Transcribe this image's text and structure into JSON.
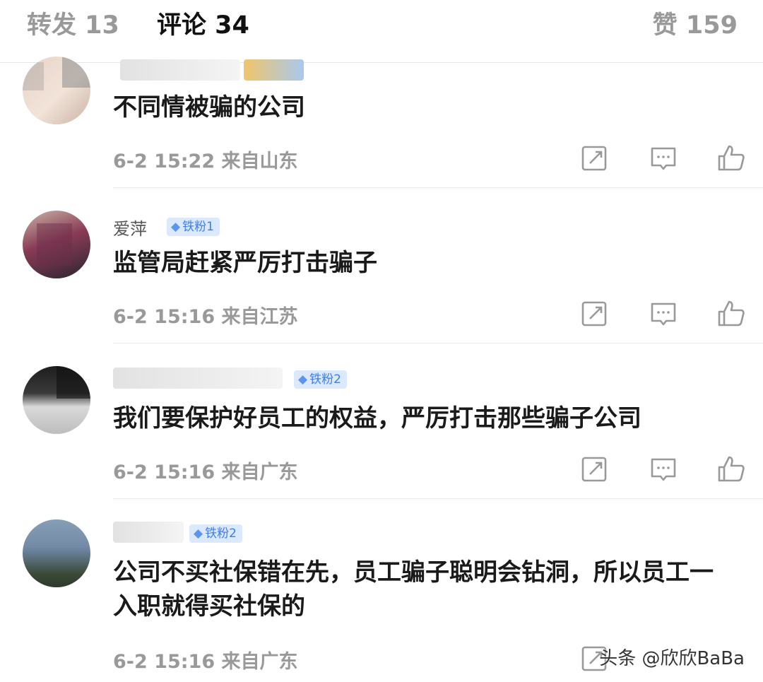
{
  "tabs": {
    "repost": "转发 13",
    "comments": "评论 34",
    "likes": "赞 159"
  },
  "comments": [
    {
      "user": "",
      "badge": "",
      "text": "不同情被骗的公司",
      "time": "6-2 15:22 来自山东"
    },
    {
      "user": "爱萍",
      "badge": "铁粉1",
      "text": "监管局赶紧严厉打击骗子",
      "time": "6-2 15:16 来自江苏"
    },
    {
      "user": "",
      "badge": "铁粉2",
      "text": "我们要保护好员工的权益，严厉打击那些骗子公司",
      "time": "6-2 15:16 来自广东"
    },
    {
      "user": "",
      "badge": "铁粉2",
      "text": "公司不买社保错在先，员工骗子聪明会钻洞，所以员工一入职就得买社保的",
      "time": "6-2 15:16 来自广东"
    }
  ],
  "icons": [
    "repost-icon",
    "reply-icon",
    "like-icon"
  ],
  "watermark": "头条 @欣欣BaBa",
  "colors": {
    "badge_bg": "#dbe9ff",
    "badge_text": "#3f7ee8",
    "muted": "#999999"
  }
}
